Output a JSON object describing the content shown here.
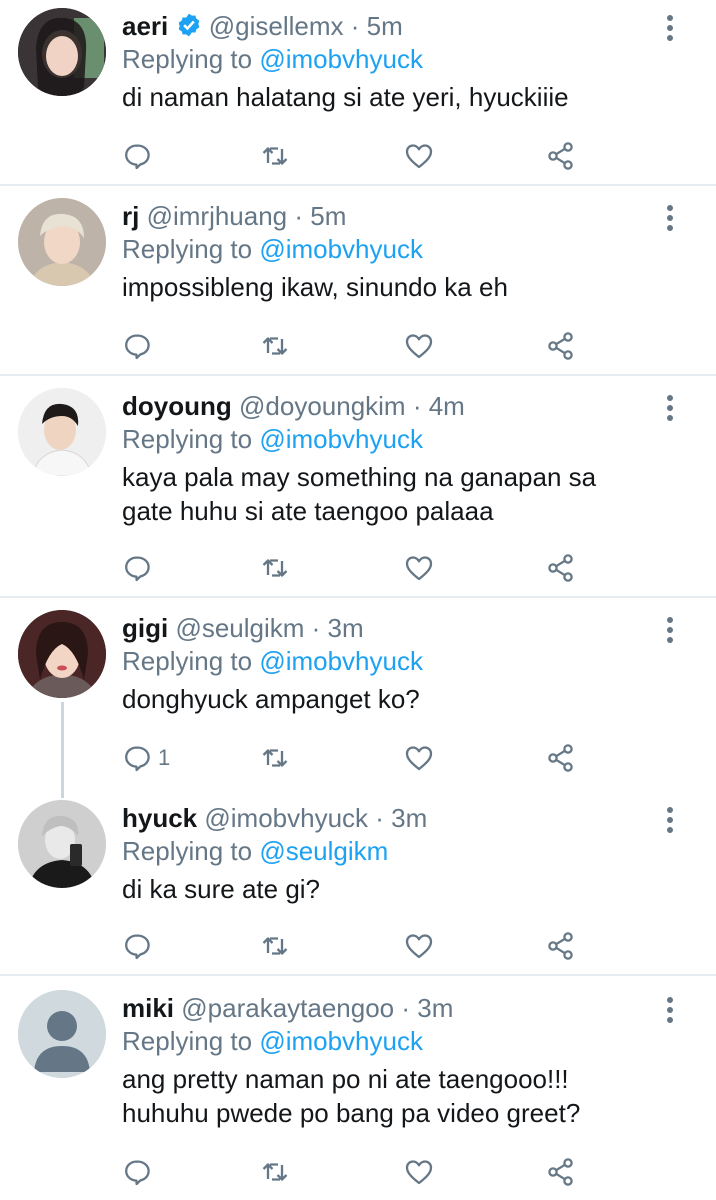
{
  "colors": {
    "accent": "#1da1f2",
    "muted": "#657786",
    "text": "#14171a",
    "divider": "#e6ecf0"
  },
  "icons": {
    "reply": "reply-icon",
    "retweet": "retweet-icon",
    "like": "heart-icon",
    "share": "share-icon",
    "more": "more-vertical-icon",
    "verified": "verified-badge-icon"
  },
  "tweets": [
    {
      "name": "aeri",
      "handle": "@gisellemx",
      "time": "· 5m",
      "replying_label": "Replying to",
      "replying_to": "@imobvhyuck",
      "text_lines": [
        "di naman halatang si ate yeri, hyuckiiie"
      ],
      "reply_count": "",
      "verified": true
    },
    {
      "name": "rj",
      "handle": "@imrjhuang",
      "time": "· 5m",
      "replying_label": "Replying to",
      "replying_to": "@imobvhyuck",
      "text_lines": [
        "impossibleng ikaw, sinundo ka eh"
      ],
      "reply_count": ""
    },
    {
      "name": "doyoung",
      "handle": "@doyoungkim",
      "time": "· 4m",
      "replying_label": "Replying to",
      "replying_to": "@imobvhyuck",
      "text_lines": [
        "kaya pala may something na ganapan sa",
        "gate huhu si ate taengoo palaaa"
      ],
      "reply_count": ""
    },
    {
      "name": "gigi",
      "handle": "@seulgikm",
      "time": "· 3m",
      "replying_label": "Replying to",
      "replying_to": "@imobvhyuck",
      "text_lines": [
        "donghyuck ampanget ko?"
      ],
      "reply_count": "1"
    },
    {
      "name": "hyuck",
      "handle": "@imobvhyuck",
      "time": "· 3m",
      "replying_label": "Replying to",
      "replying_to": "@seulgikm",
      "text_lines": [
        "di ka sure ate gi?"
      ],
      "reply_count": ""
    },
    {
      "name": "miki",
      "handle": "@parakaytaengoo",
      "time": "· 3m",
      "replying_label": "Replying to",
      "replying_to": "@imobvhyuck",
      "text_lines": [
        "ang pretty naman po ni ate taengooo!!!",
        "huhuhu pwede po bang pa video greet?"
      ],
      "reply_count": ""
    }
  ]
}
